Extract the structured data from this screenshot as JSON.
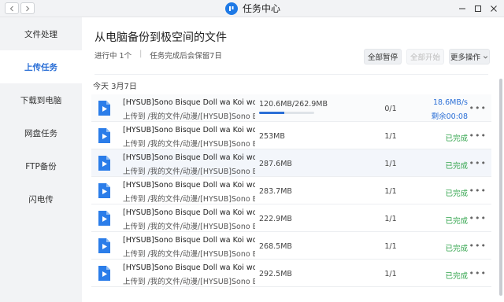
{
  "window": {
    "title": "任务中心"
  },
  "sidebar": {
    "items": [
      {
        "label": "文件处理",
        "active": false
      },
      {
        "label": "上传任务",
        "active": true
      },
      {
        "label": "下载到电脑",
        "active": false
      },
      {
        "label": "网盘任务",
        "active": false
      },
      {
        "label": "FTP备份",
        "active": false
      },
      {
        "label": "闪电传",
        "active": false
      }
    ]
  },
  "main": {
    "title": "从电脑备份到极空间的文件",
    "status_in_progress": "进行中 1个",
    "status_separator": "|",
    "status_retention": "任务完成后会保留7日",
    "buttons": {
      "pause_all": "全部暂停",
      "start_all": "全部开始",
      "more": "更多操作"
    },
    "date_header": "今天  3月7日",
    "tasks": [
      {
        "name": "[HYSUB]Sono Bisque Doll wa Koi wo S...",
        "path": "上传到 /我的文件/动漫/[HYSUB]Sono Bi...",
        "size": "120.6MB/262.9MB",
        "progress": 0.46,
        "count": "0/1",
        "speed": "18.6MB/s",
        "remaining": "剩余00:08",
        "status": ""
      },
      {
        "name": "[HYSUB]Sono Bisque Doll wa Koi wo S...",
        "path": "上传到 /我的文件/动漫/[HYSUB]Sono Bi...",
        "size": "253MB",
        "count": "1/1",
        "status": "已完成"
      },
      {
        "name": "[HYSUB]Sono Bisque Doll wa Koi wo S...",
        "path": "上传到 /我的文件/动漫/[HYSUB]Sono Bi...",
        "size": "287.6MB",
        "count": "1/1",
        "status": "已完成"
      },
      {
        "name": "[HYSUB]Sono Bisque Doll wa Koi wo S...",
        "path": "上传到 /我的文件/动漫/[HYSUB]Sono Bi...",
        "size": "283.7MB",
        "count": "1/1",
        "status": "已完成"
      },
      {
        "name": "[HYSUB]Sono Bisque Doll wa Koi wo S...",
        "path": "上传到 /我的文件/动漫/[HYSUB]Sono Bi...",
        "size": "222.9MB",
        "count": "1/1",
        "status": "已完成"
      },
      {
        "name": "[HYSUB]Sono Bisque Doll wa Koi wo S...",
        "path": "上传到 /我的文件/动漫/[HYSUB]Sono Bi...",
        "size": "268.5MB",
        "count": "1/1",
        "status": "已完成"
      },
      {
        "name": "[HYSUB]Sono Bisque Doll wa Koi wo S...",
        "path": "上传到 /我的文件/动漫/[HYSUB]Sono Bi...",
        "size": "292.5MB",
        "count": "1/1",
        "status": "已完成"
      }
    ]
  },
  "colors": {
    "accent": "#2b6fd6",
    "done": "#2fa34a",
    "file_icon": "#2b7de9"
  },
  "icons": {
    "back": "chevron-left-icon",
    "forward": "chevron-right-icon",
    "file": "video-file-icon",
    "more": "ellipsis-icon"
  }
}
